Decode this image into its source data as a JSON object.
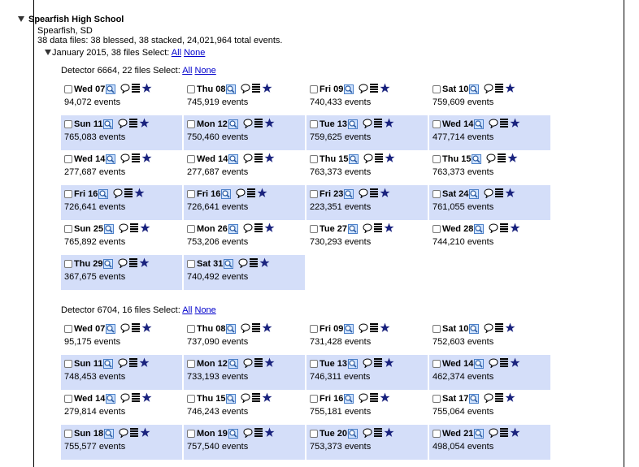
{
  "school": {
    "name": "Spearfish High School",
    "location": "Spearfish, SD",
    "summary": "38 data files: 38 blessed, 38 stacked, 24,021,964 total events."
  },
  "month": {
    "label": "January 2015, 38 files",
    "select_label": "Select:",
    "all": "All",
    "none": "None"
  },
  "detectors": [
    {
      "header": "Detector 6664, 22 files Select:",
      "all": "All",
      "none": "None",
      "files": [
        {
          "day": "Wed 07",
          "events": "94,072 events"
        },
        {
          "day": "Thu 08",
          "events": "745,919 events"
        },
        {
          "day": "Fri 09",
          "events": "740,433 events"
        },
        {
          "day": "Sat 10",
          "events": "759,609 events"
        },
        {
          "day": "Sun 11",
          "events": "765,083 events"
        },
        {
          "day": "Mon 12",
          "events": "750,460 events"
        },
        {
          "day": "Tue 13",
          "events": "759,625 events"
        },
        {
          "day": "Wed 14",
          "events": "477,714 events"
        },
        {
          "day": "Wed 14",
          "events": "277,687 events"
        },
        {
          "day": "Wed 14",
          "events": "277,687 events"
        },
        {
          "day": "Thu 15",
          "events": "763,373 events"
        },
        {
          "day": "Thu 15",
          "events": "763,373 events"
        },
        {
          "day": "Fri 16",
          "events": "726,641 events"
        },
        {
          "day": "Fri 16",
          "events": "726,641 events"
        },
        {
          "day": "Fri 23",
          "events": "223,351 events"
        },
        {
          "day": "Sat 24",
          "events": "761,055 events"
        },
        {
          "day": "Sun 25",
          "events": "765,892 events"
        },
        {
          "day": "Mon 26",
          "events": "753,206 events"
        },
        {
          "day": "Tue 27",
          "events": "730,293 events"
        },
        {
          "day": "Wed 28",
          "events": "744,210 events"
        },
        {
          "day": "Thu 29",
          "events": "367,675 events"
        },
        {
          "day": "Sat 31",
          "events": "740,492 events"
        }
      ]
    },
    {
      "header": "Detector 6704, 16 files Select:",
      "all": "All",
      "none": "None",
      "files": [
        {
          "day": "Wed 07",
          "events": "95,175 events"
        },
        {
          "day": "Thu 08",
          "events": "737,090 events"
        },
        {
          "day": "Fri 09",
          "events": "731,428 events"
        },
        {
          "day": "Sat 10",
          "events": "752,603 events"
        },
        {
          "day": "Sun 11",
          "events": "748,453 events"
        },
        {
          "day": "Mon 12",
          "events": "733,193 events"
        },
        {
          "day": "Tue 13",
          "events": "746,311 events"
        },
        {
          "day": "Wed 14",
          "events": "462,374 events"
        },
        {
          "day": "Wed 14",
          "events": "279,814 events"
        },
        {
          "day": "Thu 15",
          "events": "746,243 events"
        },
        {
          "day": "Fri 16",
          "events": "755,181 events"
        },
        {
          "day": "Sat 17",
          "events": "755,064 events"
        },
        {
          "day": "Sun 18",
          "events": "755,577 events"
        },
        {
          "day": "Mon 19",
          "events": "757,540 events"
        },
        {
          "day": "Tue 20",
          "events": "753,373 events"
        },
        {
          "day": "Wed 21",
          "events": "498,054 events"
        }
      ]
    }
  ],
  "icons": [
    "magnifier-icon",
    "comment-icon",
    "stack-icon",
    "star-icon"
  ],
  "colors": {
    "shaded_row": "#d4def9",
    "link": "#0000cc",
    "star": "#1a237e"
  }
}
